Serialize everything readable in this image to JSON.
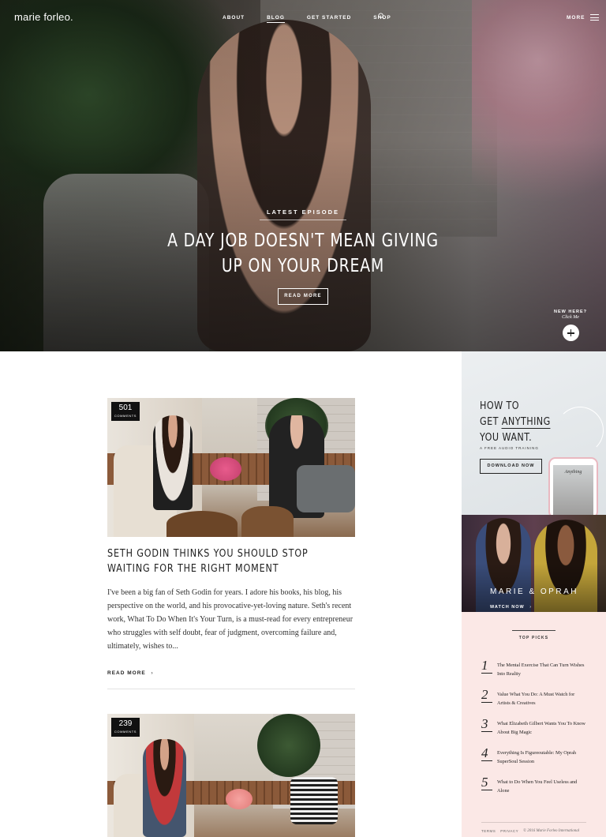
{
  "nav": {
    "logo": "marie forleo.",
    "links": [
      "ABOUT",
      "BLOG",
      "GET STARTED",
      "SHOP"
    ],
    "more": "MORE"
  },
  "hero": {
    "eyebrow": "LATEST EPISODE",
    "title": "A DAY JOB DOESN'T MEAN GIVING UP ON YOUR DREAM",
    "button": "READ MORE",
    "new_here": "NEW HERE?",
    "click_me": "Click Me"
  },
  "posts": [
    {
      "comments_count": "501",
      "comments_label": "COMMENTS",
      "title": "SETH GODIN THINKS YOU SHOULD STOP WAITING FOR THE RIGHT MOMENT",
      "excerpt": "I've been a big fan of Seth Godin for years. I adore his books, his blog, his perspective on the world, and his provocative-yet-loving nature. Seth's recent work, What To Do When It's Your Turn, is a must-read for every entrepreneur who struggles with self doubt, fear of judgment, overcoming failure and, ultimately, wishes to...",
      "read_more": "READ MORE"
    },
    {
      "comments_count": "239",
      "comments_label": "COMMENTS"
    }
  ],
  "sidebar": {
    "promo": {
      "line1": "HOW TO",
      "line2_pre": "GET ",
      "line2_u": "ANYTHING",
      "line3": "YOU WANT.",
      "sub": "A FREE AUDIO TRAINING",
      "button": "DOWNLOAD NOW",
      "phone_text": "Anything"
    },
    "oprah": {
      "title": "MARIE & OPRAH",
      "watch": "WATCH NOW"
    },
    "top_picks": {
      "heading": "TOP PICKS",
      "items": [
        {
          "num": "1",
          "text": "The Mental Exercise That Can Turn Wishes Into Reality"
        },
        {
          "num": "2",
          "text": "Value What You Do: A Must Watch for Artists & Creatives"
        },
        {
          "num": "3",
          "text": "What Elizabeth Gilbert Wants You To Know About Big Magic"
        },
        {
          "num": "4",
          "text": "Everything Is Figureoutable: My Oprah SuperSoul Session"
        },
        {
          "num": "5",
          "text": "What to Do When You Feel Useless and Alone"
        }
      ]
    },
    "footer": {
      "terms": "TERMS",
      "privacy": "PRIVACY",
      "copyright": "© 2016 Marie Forleo International"
    }
  }
}
